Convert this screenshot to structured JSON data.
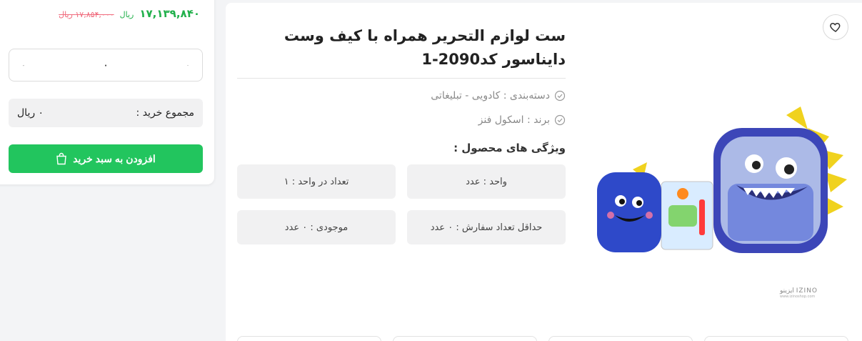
{
  "product": {
    "title": "ست لوازم التحریر همراه با کیف وست دایناسور کد2090-1",
    "category": "دسته‌بندی : کادویی - تبلیغاتی",
    "brand": "برند : اسکول فنز",
    "features_title": "ویژگی های محصول :",
    "features": [
      "واحد : عدد",
      "تعداد در واحد : ۱",
      "حداقل تعداد سفارش : ۰ عدد",
      "موجودی : ۰ عدد"
    ],
    "watermark": "IZINO",
    "watermark_fa": "ایزینو",
    "watermark_url": "www.izinoshop.com"
  },
  "purchase": {
    "price_new": "۱۷,۱۳۹,۸۴۰",
    "price_unit": "ریال",
    "price_old": "۱۷,۸۵۴,۰۰۰ ریال",
    "qty_value": "۰",
    "qty_plus": "٠",
    "qty_minus": "-",
    "total_label": "مجموع خرید :",
    "total_value": "۰ ریال",
    "add_to_cart": "افزودن به سبد خرید"
  },
  "colors": {
    "accent": "#22c55e",
    "price": "#21b04b",
    "old_price": "#f06a7c"
  },
  "icons": {
    "favorite": "heart-icon",
    "check": "check-circle-icon",
    "cart": "shopping-bag-icon"
  }
}
